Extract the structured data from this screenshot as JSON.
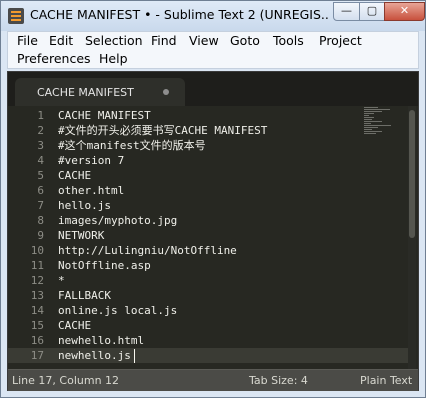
{
  "window": {
    "title": "CACHE MANIFEST • - Sublime Text 2 (UNREGIS...",
    "minimize_label": "—",
    "maximize_label": "▢",
    "close_label": "✕"
  },
  "menu": {
    "row1": [
      "File",
      "Edit",
      "Selection",
      "Find",
      "View",
      "Goto",
      "Tools",
      "Project"
    ],
    "row2": [
      "Preferences",
      "Help"
    ]
  },
  "tabs": [
    {
      "label": "CACHE MANIFEST",
      "modified": true
    }
  ],
  "editor": {
    "lines": [
      {
        "num": "1",
        "text": "CACHE MANIFEST"
      },
      {
        "num": "2",
        "text": "#文件的开头必须要书写CACHE MANIFEST"
      },
      {
        "num": "3",
        "text": "#这个manifest文件的版本号"
      },
      {
        "num": "4",
        "text": "#version 7"
      },
      {
        "num": "5",
        "text": "CACHE"
      },
      {
        "num": "6",
        "text": "other.html"
      },
      {
        "num": "7",
        "text": "hello.js"
      },
      {
        "num": "8",
        "text": "images/myphoto.jpg"
      },
      {
        "num": "9",
        "text": "NETWORK"
      },
      {
        "num": "10",
        "text": "http://Lulingniu/NotOffline"
      },
      {
        "num": "11",
        "text": "NotOffline.asp"
      },
      {
        "num": "12",
        "text": "*"
      },
      {
        "num": "13",
        "text": "FALLBACK"
      },
      {
        "num": "14",
        "text": "online.js local.js"
      },
      {
        "num": "15",
        "text": "CACHE"
      },
      {
        "num": "16",
        "text": "newhello.html"
      },
      {
        "num": "17",
        "text": "newhello.js"
      }
    ],
    "current_line": 17
  },
  "status": {
    "position": "Line 17, Column 12",
    "tab_size": "Tab Size: 4",
    "syntax": "Plain Text"
  },
  "colors": {
    "editor_bg": "#272822",
    "text": "#f0f0ea",
    "line_numbers": "#8d8d86",
    "status_bg": "#4b4b47"
  }
}
